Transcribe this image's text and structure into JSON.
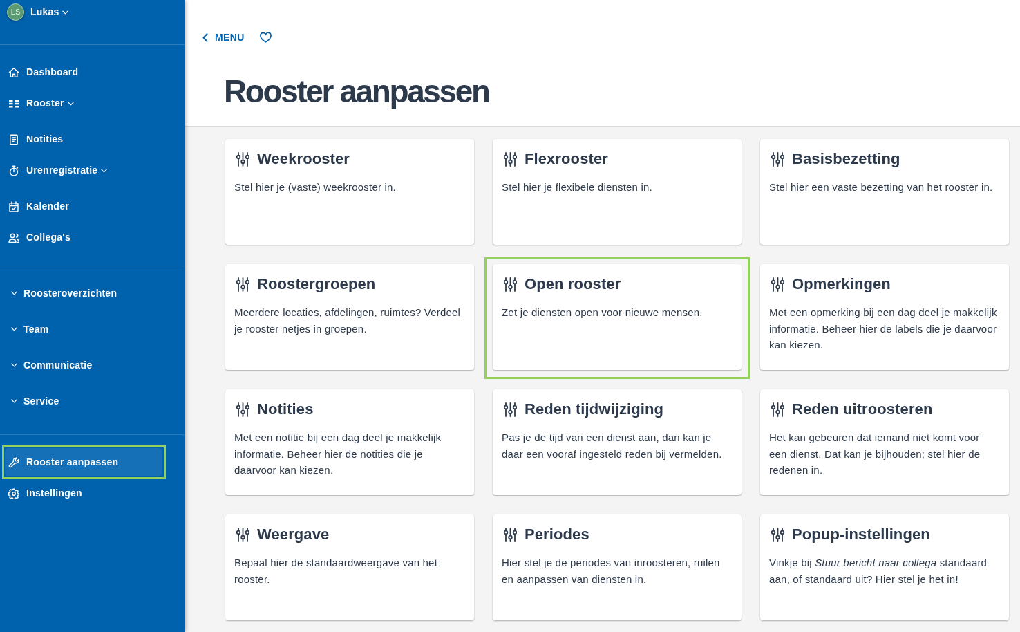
{
  "sidebar": {
    "user": {
      "initials": "LS",
      "name": "Lukas"
    },
    "sections": [
      {
        "items": [
          {
            "kind": "link",
            "label": "Dashboard",
            "expandable": false,
            "selected": false,
            "highlighted": false
          },
          {
            "kind": "link",
            "label": "Rooster",
            "expandable": true,
            "selected": false,
            "highlighted": false
          },
          {
            "kind": "link",
            "label": "Notities",
            "expandable": false,
            "selected": false,
            "highlighted": false
          },
          {
            "kind": "link",
            "label": "Urenregistratie",
            "expandable": true,
            "selected": false,
            "highlighted": false
          },
          {
            "kind": "link",
            "label": "Kalender",
            "expandable": false,
            "selected": false,
            "highlighted": false
          },
          {
            "kind": "link",
            "label": "Collega's",
            "expandable": false,
            "selected": false,
            "highlighted": false
          }
        ]
      },
      {
        "items": [
          {
            "kind": "group",
            "label": "Roosteroverzichten",
            "expandable": true,
            "selected": false,
            "highlighted": false
          },
          {
            "kind": "group",
            "label": "Team",
            "expandable": true,
            "selected": false,
            "highlighted": false
          },
          {
            "kind": "group",
            "label": "Communicatie",
            "expandable": true,
            "selected": false,
            "highlighted": false
          },
          {
            "kind": "group",
            "label": "Service",
            "expandable": true,
            "selected": false,
            "highlighted": false
          }
        ]
      },
      {
        "items": [
          {
            "kind": "link",
            "label": "Rooster aanpassen",
            "expandable": false,
            "selected": true,
            "highlighted": true
          },
          {
            "kind": "link",
            "label": "Instellingen",
            "expandable": false,
            "selected": false,
            "highlighted": false
          }
        ]
      }
    ]
  },
  "header": {
    "back_link": "MENU",
    "title": "Rooster aanpassen"
  },
  "cards": [
    {
      "title": "Weekrooster",
      "description": "Stel hier je (vaste) weekrooster in.",
      "highlighted": false
    },
    {
      "title": "Flexrooster",
      "description": "Stel hier je flexibele diensten in.",
      "highlighted": false
    },
    {
      "title": "Basisbezetting",
      "description": "Stel hier een vaste bezetting van het rooster in.",
      "highlighted": false
    },
    {
      "title": "Roostergroepen",
      "description": "Meerdere locaties, afdelingen, ruimtes? Verdeel je rooster netjes in groepen.",
      "highlighted": false
    },
    {
      "title": "Open rooster",
      "description": "Zet je diensten open voor nieuwe mensen.",
      "highlighted": true
    },
    {
      "title": "Opmerkingen",
      "description": "Met een opmerking bij een dag deel je makkelijk informatie. Beheer hier de labels die je daarvoor kan kiezen.",
      "highlighted": false
    },
    {
      "title": "Notities",
      "description": "Met een notitie bij een dag deel je makkelijk informatie. Beheer hier de notities die je daarvoor kan kiezen.",
      "highlighted": false
    },
    {
      "title": "Reden tijdwijziging",
      "description": "Pas je de tijd van een dienst aan, dan kan je daar een vooraf ingesteld reden bij vermelden.",
      "highlighted": false
    },
    {
      "title": "Reden uitroosteren",
      "description": "Het kan gebeuren dat iemand niet komt voor een dienst. Dat kan je bijhouden; stel hier de redenen in.",
      "highlighted": false
    },
    {
      "title": "Weergave",
      "description": "Bepaal hier de standaardweergave van het rooster.",
      "highlighted": false
    },
    {
      "title": "Periodes",
      "description": "Hier stel je de periodes van inroosteren, ruilen en aanpassen van diensten in.",
      "highlighted": false
    },
    {
      "title": "Popup-instellingen",
      "description": "Vinkje bij *Stuur bericht naar collega* standaard aan, of standaard uit? Hier stel je het in!",
      "highlighted": false
    }
  ]
}
